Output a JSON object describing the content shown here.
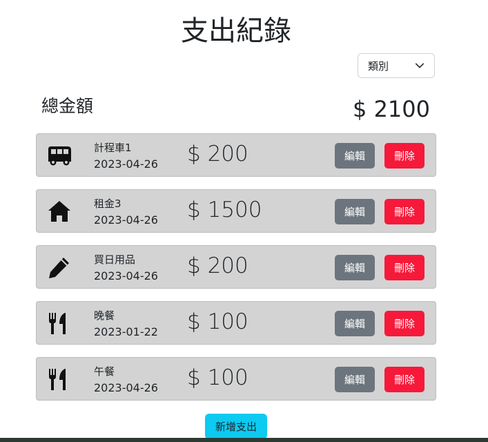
{
  "page": {
    "title": "支出紀錄"
  },
  "filter": {
    "selected": "類別",
    "icon": "chevron-down-icon"
  },
  "summary": {
    "total_label": "總金額",
    "total_amount": "$ 2100"
  },
  "records": [
    {
      "icon": "bus-icon",
      "name": "計程車1",
      "date": "2023-04-26",
      "amount": "$ 200",
      "edit_label": "編輯",
      "delete_label": "刪除"
    },
    {
      "icon": "home-icon",
      "name": "租金3",
      "date": "2023-04-26",
      "amount": "$ 1500",
      "edit_label": "編輯",
      "delete_label": "刪除"
    },
    {
      "icon": "pencil-icon",
      "name": "買日用品",
      "date": "2023-04-26",
      "amount": "$ 200",
      "edit_label": "編輯",
      "delete_label": "刪除"
    },
    {
      "icon": "utensils-icon",
      "name": "晚餐",
      "date": "2023-01-22",
      "amount": "$ 100",
      "edit_label": "編輯",
      "delete_label": "刪除"
    },
    {
      "icon": "utensils-icon",
      "name": "午餐",
      "date": "2023-04-26",
      "amount": "$ 100",
      "edit_label": "編輯",
      "delete_label": "刪除"
    }
  ],
  "actions": {
    "add_label": "新增支出"
  },
  "colors": {
    "edit": "#6c757d",
    "delete": "#f6193a",
    "add": "#0dcaf0",
    "card": "#d3d3d3"
  }
}
